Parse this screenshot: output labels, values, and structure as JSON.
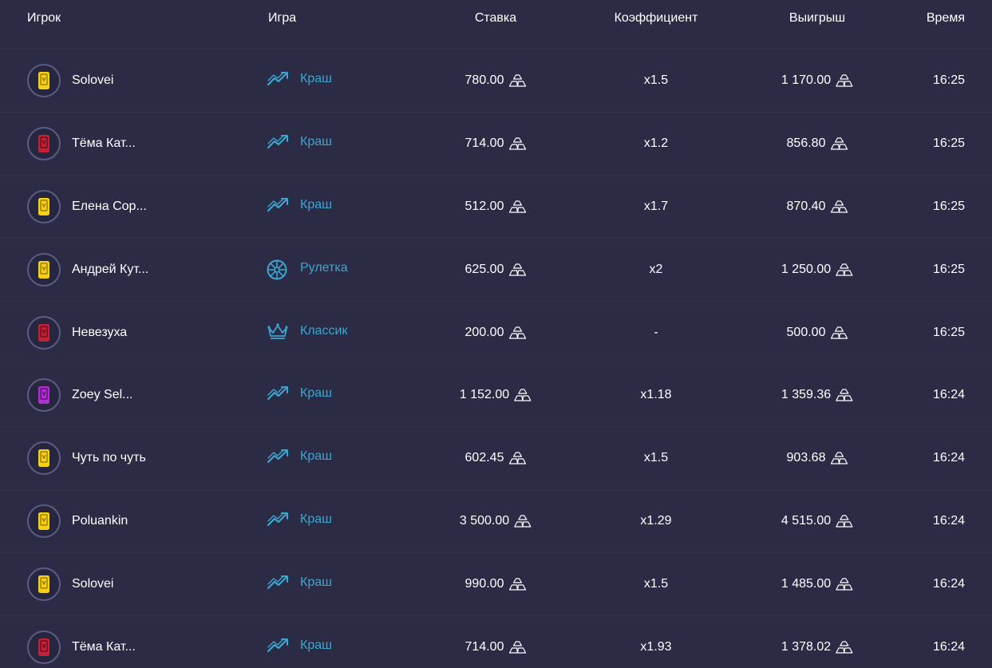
{
  "header": {
    "player": "Игрок",
    "game": "Игра",
    "bet": "Ставка",
    "coef": "Коэффициент",
    "win": "Выигрыш",
    "time": "Время"
  },
  "colors": {
    "background": "#2b2b46",
    "game_link": "#3ba7cf",
    "rank_gold": "#f7d117",
    "rank_red": "#c2213a",
    "rank_purple": "#b02fd0"
  },
  "rows": [
    {
      "player": "Solovei",
      "rank": "gold",
      "game": "Краш",
      "game_icon": "crash-chart-icon",
      "bet": "780.00",
      "coef": "x1.5",
      "win": "1 170.00",
      "time": "16:25"
    },
    {
      "player": "Тёма Кат...",
      "rank": "red",
      "game": "Краш",
      "game_icon": "crash-chart-icon",
      "bet": "714.00",
      "coef": "x1.2",
      "win": "856.80",
      "time": "16:25"
    },
    {
      "player": "Елена Сор...",
      "rank": "gold",
      "game": "Краш",
      "game_icon": "crash-chart-icon",
      "bet": "512.00",
      "coef": "x1.7",
      "win": "870.40",
      "time": "16:25"
    },
    {
      "player": "Андрей Кут...",
      "rank": "gold",
      "game": "Рулетка",
      "game_icon": "roulette-wheel-icon",
      "bet": "625.00",
      "coef": "x2",
      "win": "1 250.00",
      "time": "16:25"
    },
    {
      "player": "Невезуха",
      "rank": "red",
      "game": "Классик",
      "game_icon": "crown-icon",
      "bet": "200.00",
      "coef": "-",
      "win": "500.00",
      "time": "16:25"
    },
    {
      "player": "Zoey Sel...",
      "rank": "purple",
      "game": "Краш",
      "game_icon": "crash-chart-icon",
      "bet": "1 152.00",
      "coef": "x1.18",
      "win": "1 359.36",
      "time": "16:24"
    },
    {
      "player": "Чуть по чуть",
      "rank": "gold",
      "game": "Краш",
      "game_icon": "crash-chart-icon",
      "bet": "602.45",
      "coef": "x1.5",
      "win": "903.68",
      "time": "16:24"
    },
    {
      "player": "Poluankin",
      "rank": "gold",
      "game": "Краш",
      "game_icon": "crash-chart-icon",
      "bet": "3 500.00",
      "coef": "x1.29",
      "win": "4 515.00",
      "time": "16:24"
    },
    {
      "player": "Solovei",
      "rank": "gold",
      "game": "Краш",
      "game_icon": "crash-chart-icon",
      "bet": "990.00",
      "coef": "x1.5",
      "win": "1 485.00",
      "time": "16:24"
    },
    {
      "player": "Тёма Кат...",
      "rank": "red",
      "game": "Краш",
      "game_icon": "crash-chart-icon",
      "bet": "714.00",
      "coef": "x1.93",
      "win": "1 378.02",
      "time": "16:24"
    }
  ]
}
